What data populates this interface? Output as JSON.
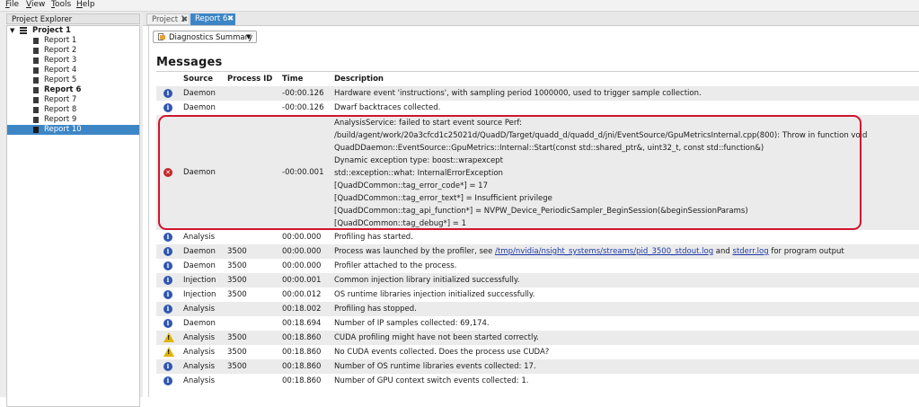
{
  "menu": [
    "File",
    "View",
    "Tools",
    "Help"
  ],
  "explorer": {
    "title": "Project Explorer",
    "root": "Project 1",
    "reports": [
      "Report 1",
      "Report 2",
      "Report 3",
      "Report 4",
      "Report 5",
      "Report 6",
      "Report 7",
      "Report 8",
      "Report 9",
      "Report 10"
    ],
    "bold_report": "Report 6",
    "selected_report": "Report 10"
  },
  "tabs": [
    {
      "label": "Project 1",
      "close": "✖"
    },
    {
      "label": "Report 6",
      "close": "✖"
    }
  ],
  "view_select": {
    "value": "Diagnostics Summary",
    "caret": "▼"
  },
  "messages": {
    "title": "Messages",
    "columns": [
      "Source",
      "Process ID",
      "Time",
      "Description"
    ],
    "rows": [
      {
        "icon": "info-icon",
        "source": "Daemon",
        "pid": "",
        "time": "-00:00.126",
        "desc": "Hardware event 'instructions', with sampling period 1000000, used to trigger sample collection."
      },
      {
        "icon": "info-icon",
        "source": "Daemon",
        "pid": "",
        "time": "-00:00.126",
        "desc": "Dwarf backtraces collected."
      },
      {
        "icon": "error-icon",
        "source": "Daemon",
        "pid": "",
        "time": "-00:00.001",
        "lines": [
          "AnalysisService: failed to start event source Perf:",
          "/build/agent/work/20a3cfcd1c25021d/QuadD/Target/quadd_d/quadd_d/jni/EventSource/GpuMetricsInternal.cpp(800): Throw in function void",
          "QuadDDaemon::EventSource::GpuMetrics::Internal::Start(const std::shared_ptr&, uint32_t, const std::function&)",
          "Dynamic exception type: boost::wrapexcept",
          "std::exception::what: InternalErrorException",
          "[QuadDCommon::tag_error_code*] = 17",
          "[QuadDCommon::tag_error_text*] = Insufficient privilege",
          "[QuadDCommon::tag_api_function*] = NVPW_Device_PeriodicSampler_BeginSession(&beginSessionParams)",
          "[QuadDCommon::tag_debug*] = 1"
        ]
      },
      {
        "icon": "info-icon",
        "source": "Analysis",
        "pid": "",
        "time": "00:00.000",
        "desc": "Profiling has started."
      },
      {
        "icon": "info-icon",
        "source": "Daemon",
        "pid": "3500",
        "time": "00:00.000",
        "desc_prefix": "Process was launched by the profiler, see ",
        "link1": "/tmp/nvidia/nsight_systems/streams/pid_3500_stdout.log",
        "desc_mid": " and ",
        "link2": "stderr.log",
        "desc_suffix": " for program output"
      },
      {
        "icon": "info-icon",
        "source": "Daemon",
        "pid": "3500",
        "time": "00:00.000",
        "desc": "Profiler attached to the process."
      },
      {
        "icon": "info-icon",
        "source": "Injection",
        "pid": "3500",
        "time": "00:00.001",
        "desc": "Common injection library initialized successfully."
      },
      {
        "icon": "info-icon",
        "source": "Injection",
        "pid": "3500",
        "time": "00:00.012",
        "desc": "OS runtime libraries injection initialized successfully."
      },
      {
        "icon": "info-icon",
        "source": "Analysis",
        "pid": "",
        "time": "00:18.002",
        "desc": "Profiling has stopped."
      },
      {
        "icon": "info-icon",
        "source": "Daemon",
        "pid": "",
        "time": "00:18.694",
        "desc": "Number of IP samples collected: 69,174."
      },
      {
        "icon": "warning-icon",
        "source": "Analysis",
        "pid": "3500",
        "time": "00:18.860",
        "desc": "CUDA profiling might have not been started correctly."
      },
      {
        "icon": "warning-icon",
        "source": "Analysis",
        "pid": "3500",
        "time": "00:18.860",
        "desc": "No CUDA events collected. Does the process use CUDA?"
      },
      {
        "icon": "info-icon",
        "source": "Analysis",
        "pid": "3500",
        "time": "00:18.860",
        "desc": "Number of OS runtime libraries events collected: 17."
      },
      {
        "icon": "info-icon",
        "source": "Analysis",
        "pid": "",
        "time": "00:18.860",
        "desc": "Number of GPU context switch events collected: 1."
      }
    ]
  },
  "colors": {
    "accent": "#3d86c6",
    "error_outline": "#d0152e",
    "link": "#1e3aa8"
  }
}
